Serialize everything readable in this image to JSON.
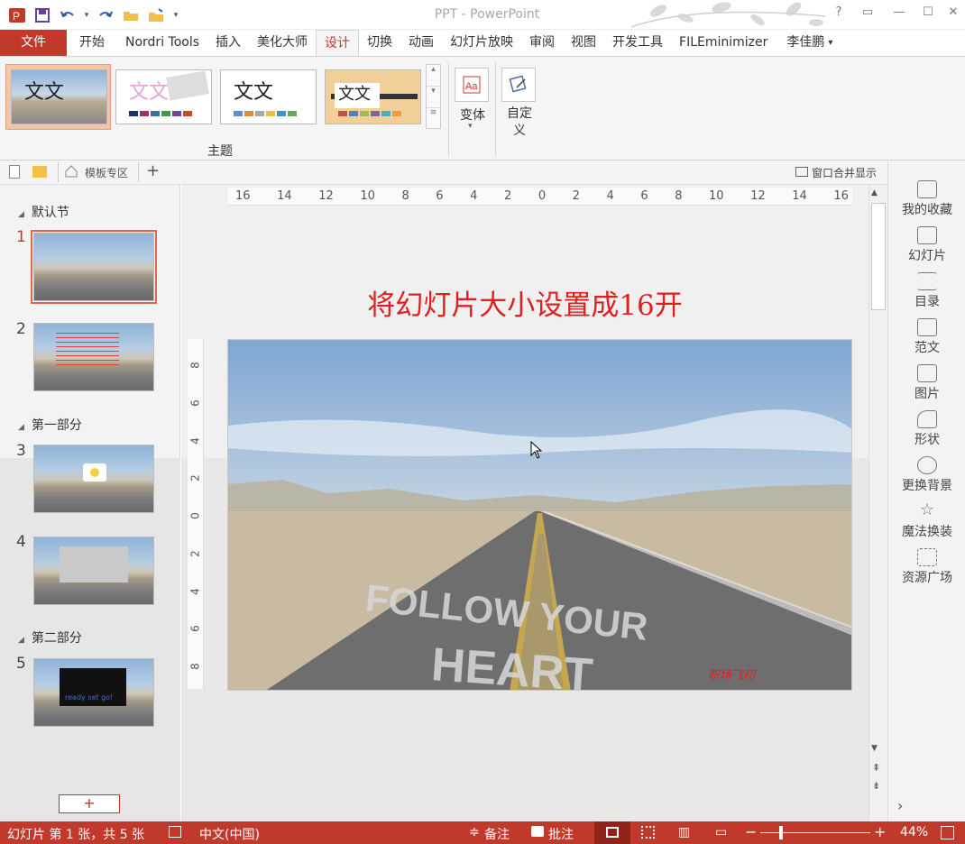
{
  "window": {
    "title": "PPT - PowerPoint",
    "help": "?"
  },
  "ribbon_tabs": [
    "文件",
    "开始",
    "Nordri Tools",
    "插入",
    "美化大师",
    "设计",
    "切换",
    "动画",
    "幻灯片放映",
    "审阅",
    "视图",
    "开发工具",
    "FILEminimizer"
  ],
  "user": "李佳鹏",
  "themes": {
    "sample_text": "文文",
    "group_label": "主题"
  },
  "variants": {
    "label": "变体"
  },
  "customize": {
    "label": "自定\n义"
  },
  "tabbar": {
    "template_tab": "模板专区",
    "add": "+",
    "window_merge": "窗口合并显示"
  },
  "ruler": {
    "labels": [
      "16",
      "14",
      "12",
      "10",
      "8",
      "6",
      "4",
      "2",
      "0",
      "2",
      "4",
      "6",
      "8",
      "10",
      "12",
      "14",
      "16"
    ],
    "vlabels": [
      "8",
      "6",
      "4",
      "2",
      "0",
      "2",
      "4",
      "6",
      "8"
    ]
  },
  "sections": [
    {
      "name": "默认节",
      "slides": [
        "1",
        "2"
      ]
    },
    {
      "name": "第一部分",
      "slides": [
        "3",
        "4"
      ]
    },
    {
      "name": "第二部分",
      "slides": [
        "5"
      ]
    }
  ],
  "slide": {
    "title": "将幻灯片大小设置成16开",
    "road_text_1": "FOLLOW YOUR",
    "road_text_2": "HEART",
    "signature": "职场飞叨"
  },
  "thumb5_text": "ready set go!",
  "add_slide": "+",
  "right_panel": [
    "我的收藏",
    "幻灯片",
    "目录",
    "范文",
    "图片",
    "形状",
    "更换背景",
    "魔法换装",
    "资源广场"
  ],
  "status": {
    "slide_info": "幻灯片 第 1 张，共 5 张",
    "language": "中文(中国)",
    "notes": "备注",
    "comments": "批注",
    "zoom": "44%",
    "zoom_minus": "−",
    "zoom_plus": "+"
  },
  "colors": {
    "accent": "#c0392b",
    "slide_title": "#e02020"
  }
}
